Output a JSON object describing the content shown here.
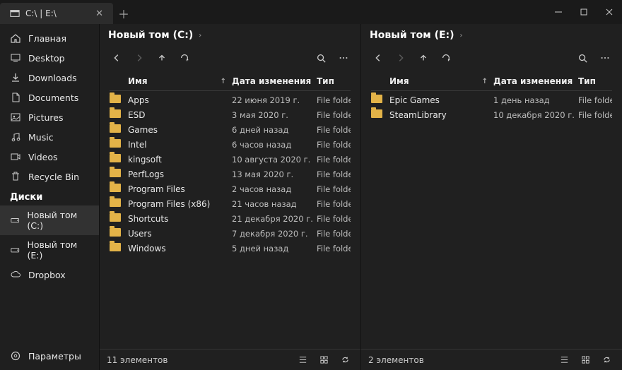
{
  "window": {
    "tab_title": "C:\\ | E:\\"
  },
  "sidebar": {
    "items": [
      {
        "label": "Главная",
        "icon": "home"
      },
      {
        "label": "Desktop",
        "icon": "desktop"
      },
      {
        "label": "Downloads",
        "icon": "download"
      },
      {
        "label": "Documents",
        "icon": "documents"
      },
      {
        "label": "Pictures",
        "icon": "pictures"
      },
      {
        "label": "Music",
        "icon": "music"
      },
      {
        "label": "Videos",
        "icon": "videos"
      },
      {
        "label": "Recycle Bin",
        "icon": "trash"
      }
    ],
    "drives_header": "Диски",
    "drives": [
      {
        "label": "Новый том (C:)",
        "active": true
      },
      {
        "label": "Новый том (E:)",
        "active": false
      },
      {
        "label": "Dropbox",
        "active": false
      }
    ],
    "settings": "Параметры"
  },
  "headers": {
    "name": "Имя",
    "date": "Дата изменения",
    "type": "Тип"
  },
  "pane_left": {
    "title": "Новый том (C:)",
    "status": "11 элементов",
    "rows": [
      {
        "name": "Apps",
        "date": "22 июня 2019 г.",
        "type": "File folder"
      },
      {
        "name": "ESD",
        "date": "3 мая 2020 г.",
        "type": "File folder"
      },
      {
        "name": "Games",
        "date": "6 дней назад",
        "type": "File folder"
      },
      {
        "name": "Intel",
        "date": "6 часов назад",
        "type": "File folder"
      },
      {
        "name": "kingsoft",
        "date": "10 августа 2020 г.",
        "type": "File folder"
      },
      {
        "name": "PerfLogs",
        "date": "13 мая 2020 г.",
        "type": "File folder"
      },
      {
        "name": "Program Files",
        "date": "2 часов назад",
        "type": "File folder"
      },
      {
        "name": "Program Files (x86)",
        "date": "21 часов назад",
        "type": "File folder"
      },
      {
        "name": "Shortcuts",
        "date": "21 декабря 2020 г.",
        "type": "File folder"
      },
      {
        "name": "Users",
        "date": "7 декабря 2020 г.",
        "type": "File folder"
      },
      {
        "name": "Windows",
        "date": "5 дней назад",
        "type": "File folder"
      }
    ]
  },
  "pane_right": {
    "title": "Новый том (E:)",
    "status": "2 элементов",
    "rows": [
      {
        "name": "Epic Games",
        "date": "1 день назад",
        "type": "File folder"
      },
      {
        "name": "SteamLibrary",
        "date": "10 декабря 2020 г.",
        "type": "File folder"
      }
    ]
  }
}
